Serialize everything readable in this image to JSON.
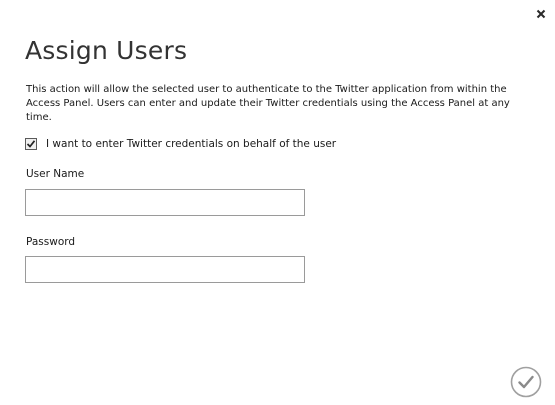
{
  "dialog": {
    "title": "Assign Users",
    "description": "This action will allow the selected user to authenticate to the Twitter application from within the Access Panel. Users can enter and update their Twitter credentials using the Access Panel at any time.",
    "checkbox": {
      "label": "I want to enter Twitter credentials on behalf of the user",
      "checked": true
    },
    "fields": {
      "username": {
        "label": "User Name",
        "value": ""
      },
      "password": {
        "label": "Password",
        "value": ""
      }
    },
    "icons": {
      "close": "close-icon",
      "confirm": "checkmark-icon"
    },
    "colors": {
      "text": "#1a1a1a",
      "title": "#333333",
      "border": "#9a9a9a",
      "icon": "#a0a0a0"
    }
  }
}
